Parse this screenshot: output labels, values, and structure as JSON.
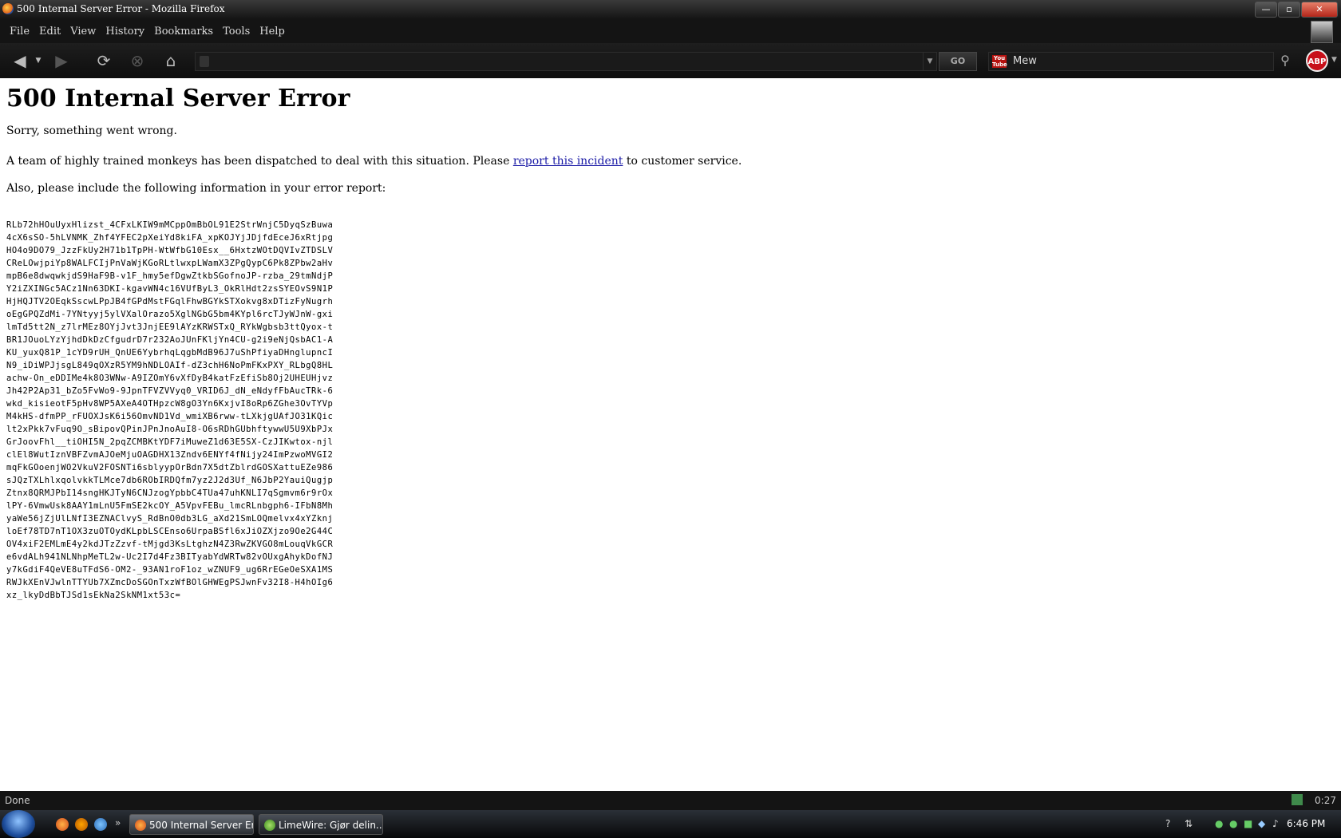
{
  "window": {
    "title": "500 Internal Server Error - Mozilla Firefox",
    "buttons": {
      "minimize": "—",
      "maximize": "▫",
      "close": "✕"
    }
  },
  "menubar": {
    "items": [
      {
        "label": "File"
      },
      {
        "label": "Edit"
      },
      {
        "label": "View"
      },
      {
        "label": "History"
      },
      {
        "label": "Bookmarks"
      },
      {
        "label": "Tools"
      },
      {
        "label": "Help"
      }
    ]
  },
  "toolbar": {
    "go_label": "GO",
    "url_value": "",
    "search_engine_icon": "youtube-icon",
    "search_value": "Mew",
    "abp_label": "ABP"
  },
  "content": {
    "heading": "500 Internal Server Error",
    "sorry": "Sorry, something went wrong.",
    "team_text_before": "A team of highly trained monkeys has been dispatched to deal with this situation. Please ",
    "report_link": "report this incident",
    "team_text_after": " to customer service.",
    "also_text": "Also, please include the following information in your error report:",
    "error_lines": [
      "RLb72hHOuUyxHlizst_4CFxLKIW9mMCppOmBbOL91E2StrWnjC5DyqSzBuwa",
      "4cX6sSO-5hLVNMK_Zhf4YFEC2pXeiYd8kiFA_xpKOJYjJDjfdEceJ6xRtjpg",
      "HO4o9DO79_JzzFkUy2H71b1TpPH-WtWfbG10Esx__6HxtzWOtDQVIvZTDSLV",
      "CReLOwjpiYp8WALFCIjPnVaWjKGoRLtlwxpLWamX3ZPgQypC6Pk8ZPbw2aHv",
      "mpB6e8dwqwkjdS9HaF9B-v1F_hmy5efDgwZtkbSGofnoJP-rzba_29tmNdjP",
      "Y2iZXINGc5ACz1Nn63DKI-kgavWN4c16VUfByL3_OkRlHdt2zsSYEOvS9N1P",
      "HjHQJTV2OEqkSscwLPpJB4fGPdMstFGqlFhwBGYkSTXokvg8xDTizFyNugrh",
      "oEgGPQZdMi-7YNtyyj5ylVXalOrazo5XglNGbG5bm4KYpl6rcTJyWJnW-gxi",
      "lmTd5tt2N_z7lrMEz8OYjJvt3JnjEE9lAYzKRWSTxQ_RYkWgbsb3ttQyox-t",
      "BR1JOuoLYzYjhdDkDzCfgudrD7r232AoJUnFKljYn4CU-g2i9eNjQsbAC1-A",
      "KU_yuxQ81P_1cYD9rUH_QnUE6YybrhqLqgbMdB96J7uShPfiyaDHnglupncI",
      "N9_iDiWPJjsgL849qOXzR5YM9hNDLOAIf-dZ3chH6NoPmFKxPXY_RLbgQ8HL",
      "achw-On_eDDIMe4k8O3WNw-A9IZOmY6vXfDyB4katFzEfiSb8Oj2UHEUHjvz",
      "Jh42P2Ap31_bZo5FvWo9-9JpnTFVZVVyq0_VRID6J_dN_eNdyfFbAucTRk-6",
      "wkd_kisieotF5pHv8WP5AXeA4OTHpzcW8gO3Yn6KxjvI8oRp6ZGhe3OvTYVp",
      "M4kHS-dfmPP_rFUOXJsK6i56OmvND1Vd_wmiXB6rww-tLXkjgUAfJO31KQic",
      "lt2xPkk7vFuq9O_sBipovQPinJPnJnoAuI8-O6sRDhGUbhftywwU5U9XbPJx",
      "GrJoovFhl__tiOHI5N_2pqZCMBKtYDF7iMuweZ1d63E5SX-CzJIKwtox-njl",
      "clEl8WutIznVBFZvmAJOeMjuOAGDHX13Zndv6ENYf4fNijy24ImPzwoMVGI2",
      "mqFkGOoenjWO2VkuV2FOSNTi6sblyypOrBdn7X5dtZblrdGOSXattuEZe986",
      "sJQzTXLhlxqolvkkTLMce7db6RObIRDQfm7yz2J2d3Uf_N6JbP2YauiQugjp",
      "Ztnx8QRMJPbI14sngHKJTyN6CNJzogYpbbC4TUa47uhKNLI7qSgmvm6r9rOx",
      "lPY-6VmwUsk8AAY1mLnU5FmSE2kcOY_A5VpvFEBu_lmcRLnbgph6-IFbN8Mh",
      "yaWe56jZjUlLNfI3EZNAClvyS_RdBnO0db3LG_aXd21SmLOQmelvx4xYZknj",
      "loEf78TD7nT1OX3zuOTOydKLpbLSCEnso6UrpaBSfl6xJiOZXjzo9Oe2G44C",
      "OV4xiF2EMLmE4y2kdJTzZzvf-tMjgd3KsLtghzN4Z3RwZKVGO8mLouqVkGCR",
      "e6vdALh941NLNhpMeTL2w-Uc2I7d4Fz3BITyabYdWRTw82vOUxgAhykDofNJ",
      "y7kGdiF4QeVE8uTFdS6-OM2-_93AN1roF1oz_wZNUF9_ug6RrEGeOeSXA1MS",
      "RWJkXEnVJwlnTTYUb7XZmcDoSGOnTxzWfBOlGHWEgPSJwnFv32I8-H4hOIg6",
      "xz_lkyDdBbTJSd1sEkNa2SkNM1xt53c="
    ]
  },
  "statusbar": {
    "text": "Done",
    "time": "0:27"
  },
  "taskbar": {
    "tasks": [
      {
        "label": "500 Internal Server Er...",
        "active": true
      },
      {
        "label": "LimeWire: Gjør delin...",
        "active": false
      }
    ],
    "clock": "6:46 PM"
  },
  "colors": {
    "link": "#1a1aa6",
    "chrome_dark": "#141414"
  }
}
